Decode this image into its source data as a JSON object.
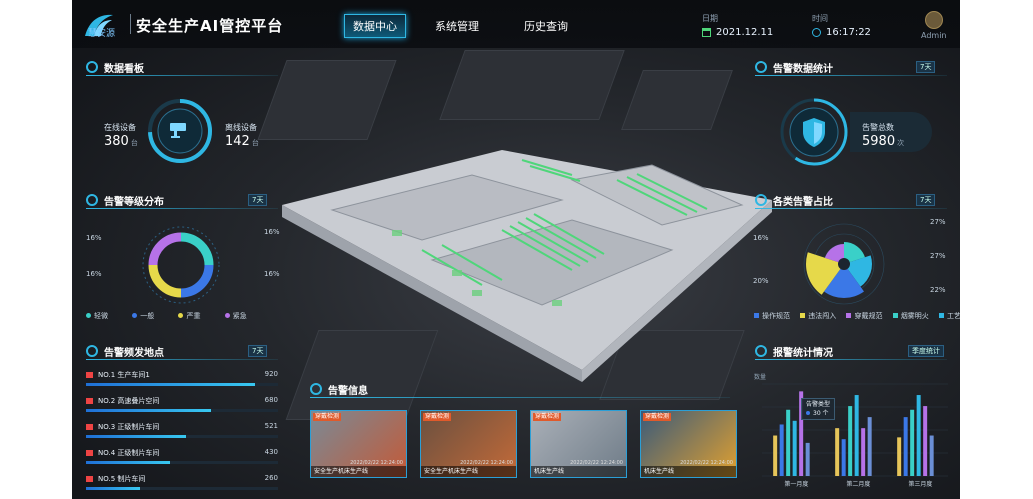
{
  "header": {
    "logo_text": "慧安源",
    "title": "安全生产AI管控平台",
    "nav": [
      "数据中心",
      "系统管理",
      "历史查询"
    ],
    "active_nav": "数据中心",
    "date_label": "日期",
    "date_value": "2021.12.11",
    "time_label": "时间",
    "time_value": "16:17:22",
    "user": "Admin"
  },
  "data_board": {
    "title": "数据看板",
    "online_label": "在线设备",
    "online_value": "380",
    "offline_label": "离线设备",
    "offline_value": "142",
    "unit": "台"
  },
  "alarm_level": {
    "title": "告警等级分布",
    "range_tag": "7天",
    "labels": [
      "16%",
      "16%",
      "16%",
      "16%"
    ],
    "legend": [
      "轻微",
      "一般",
      "严重",
      "紧急"
    ],
    "colors": [
      "#3ad0c8",
      "#3b78e7",
      "#e6d94a",
      "#b672e8"
    ]
  },
  "hotspots": {
    "title": "告警频发地点",
    "range_tag": "7天",
    "items": [
      {
        "label": "NO.1 生产车间1",
        "value": "920",
        "fraction": 0.88
      },
      {
        "label": "NO.2 高速叠片空间",
        "value": "680",
        "fraction": 0.65
      },
      {
        "label": "NO.3 正级制片车间",
        "value": "521",
        "fraction": 0.52
      },
      {
        "label": "NO.4 正级制片车间",
        "value": "430",
        "fraction": 0.44
      },
      {
        "label": "NO.5 制片车间",
        "value": "260",
        "fraction": 0.28
      }
    ]
  },
  "alarm_info": {
    "title": "告警信息",
    "cards": [
      {
        "tag": "穿戴检测",
        "time": "2022/02/22 12:24:00",
        "caption": "安全生产机床生产线"
      },
      {
        "tag": "穿戴检测",
        "time": "2022/02/22 12:24:00",
        "caption": "安全生产机床生产线"
      },
      {
        "tag": "穿戴检测",
        "time": "2022/02/22 12:24:00",
        "caption": "机床生产线"
      },
      {
        "tag": "穿戴检测",
        "time": "2022/02/22 12:24:00",
        "caption": "机床生产线"
      }
    ]
  },
  "alarm_stats": {
    "title": "告警数据统计",
    "range_tag": "7天",
    "total_label": "告警总数",
    "total_value": "5980",
    "unit": "次"
  },
  "alarm_types": {
    "title": "各类告警占比",
    "range_tag": "7天",
    "labels_right": [
      "27%",
      "27%",
      "22%"
    ],
    "labels_left": [
      "16%",
      "20%"
    ],
    "legend": [
      "操作规范",
      "违法闯入",
      "穿戴规范",
      "烟雾明火",
      "工艺异常"
    ],
    "colors": [
      "#3b78e7",
      "#e6d94a",
      "#b672e8",
      "#3ad0c8",
      "#2fb7e3"
    ]
  },
  "report_stats": {
    "title": "报警统计情况",
    "range_tag": "季度统计",
    "y_axis_label": "数量",
    "tooltip_title": "告警类型",
    "tooltip_value": "30 个",
    "chart_data": {
      "type": "bar",
      "categories": [
        "第一月度",
        "第二月度",
        "第三月度"
      ],
      "series": [
        {
          "values": [
            22,
            26,
            21
          ],
          "color": "#e6c55a"
        },
        {
          "values": [
            28,
            20,
            32
          ],
          "color": "#3b78e7"
        },
        {
          "values": [
            36,
            38,
            36
          ],
          "color": "#3ad0c8"
        },
        {
          "values": [
            30,
            44,
            44
          ],
          "color": "#2fb7e3"
        },
        {
          "values": [
            46,
            26,
            38
          ],
          "color": "#b672e8"
        },
        {
          "values": [
            18,
            32,
            22
          ],
          "color": "#6b8fd6"
        }
      ],
      "ylim": [
        0,
        50
      ]
    }
  }
}
